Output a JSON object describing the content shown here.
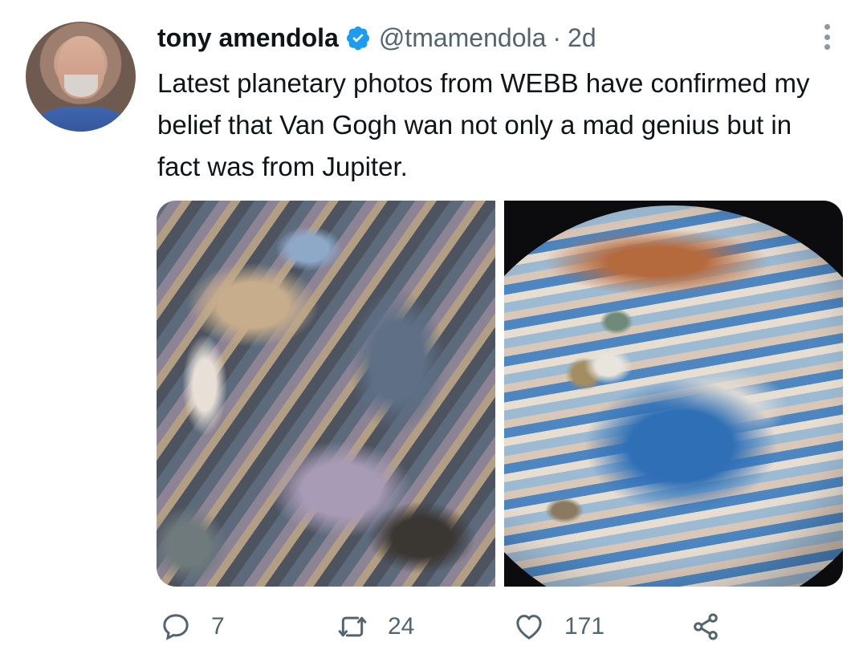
{
  "tweet": {
    "author_name": "tony amendola",
    "handle": "@tmamendola",
    "separator": "·",
    "time": "2d",
    "text": "Latest planetary photos from WEBB have confirmed my belief that Van Gogh wan not only a mad genius but in fact was from Jupiter.",
    "verified": true,
    "media_count": 2
  },
  "actions": {
    "replies": "7",
    "retweets": "24",
    "likes": "171"
  },
  "colors": {
    "verified_badge": "#1d9bf0",
    "secondary_text": "#536471",
    "primary_text": "#0f1419"
  },
  "icons": {
    "reply": "reply-bubble-icon",
    "retweet": "retweet-icon",
    "like": "heart-icon",
    "share": "share-icon",
    "more": "more-dots-icon",
    "verified": "verified-badge-icon"
  }
}
